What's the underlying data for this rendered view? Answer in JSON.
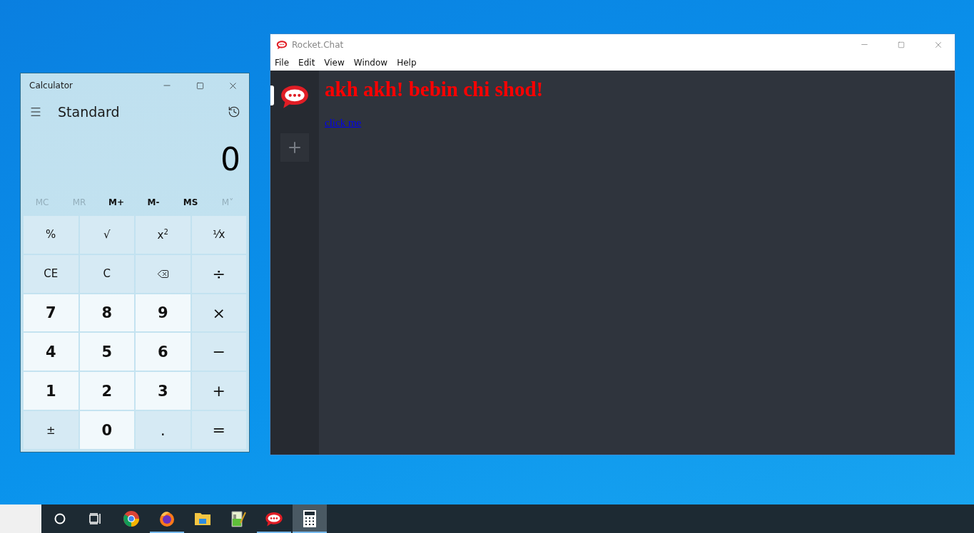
{
  "calculator": {
    "title": "Calculator",
    "mode": "Standard",
    "display": "0",
    "memory_buttons": [
      {
        "label": "MC",
        "disabled": true
      },
      {
        "label": "MR",
        "disabled": true
      },
      {
        "label": "M+",
        "disabled": false
      },
      {
        "label": "M-",
        "disabled": false
      },
      {
        "label": "MS",
        "disabled": false
      },
      {
        "label": "M˅",
        "disabled": true
      }
    ],
    "keys": [
      {
        "label": "%",
        "kind": "function"
      },
      {
        "label": "√",
        "kind": "function"
      },
      {
        "label": "x$^{2}$",
        "kind": "function"
      },
      {
        "label": "¹⁄x",
        "kind": "function"
      },
      {
        "label": "CE",
        "kind": "function"
      },
      {
        "label": "C",
        "kind": "function"
      },
      {
        "kind": "backspace"
      },
      {
        "label": "÷",
        "kind": "operator"
      },
      {
        "label": "7",
        "kind": "digit"
      },
      {
        "label": "8",
        "kind": "digit"
      },
      {
        "label": "9",
        "kind": "digit"
      },
      {
        "label": "×",
        "kind": "operator"
      },
      {
        "label": "4",
        "kind": "digit"
      },
      {
        "label": "5",
        "kind": "digit"
      },
      {
        "label": "6",
        "kind": "digit"
      },
      {
        "label": "−",
        "kind": "operator"
      },
      {
        "label": "1",
        "kind": "digit"
      },
      {
        "label": "2",
        "kind": "digit"
      },
      {
        "label": "3",
        "kind": "digit"
      },
      {
        "label": "+",
        "kind": "operator"
      },
      {
        "label": "±",
        "kind": "function"
      },
      {
        "label": "0",
        "kind": "digit"
      },
      {
        "label": ".",
        "kind": "operator"
      },
      {
        "label": "=",
        "kind": "operator"
      }
    ]
  },
  "rocket_chat": {
    "title": "Rocket.Chat",
    "menu": [
      "File",
      "Edit",
      "View",
      "Window",
      "Help"
    ],
    "servers": [
      {
        "selected": true
      }
    ],
    "heading": "akh akh! bebin chi shod!",
    "link": "click me"
  },
  "taskbar": {
    "items": [
      {
        "kind": "search",
        "running": false,
        "active": false
      },
      {
        "kind": "taskview",
        "running": false,
        "active": false
      },
      {
        "kind": "chrome",
        "running": false,
        "active": false
      },
      {
        "kind": "firefox",
        "running": true,
        "active": false
      },
      {
        "kind": "folder",
        "running": false,
        "active": false
      },
      {
        "kind": "notepad",
        "running": false,
        "active": false
      },
      {
        "kind": "chat",
        "running": true,
        "active": false
      },
      {
        "kind": "calculator",
        "running": true,
        "active": true
      }
    ]
  }
}
